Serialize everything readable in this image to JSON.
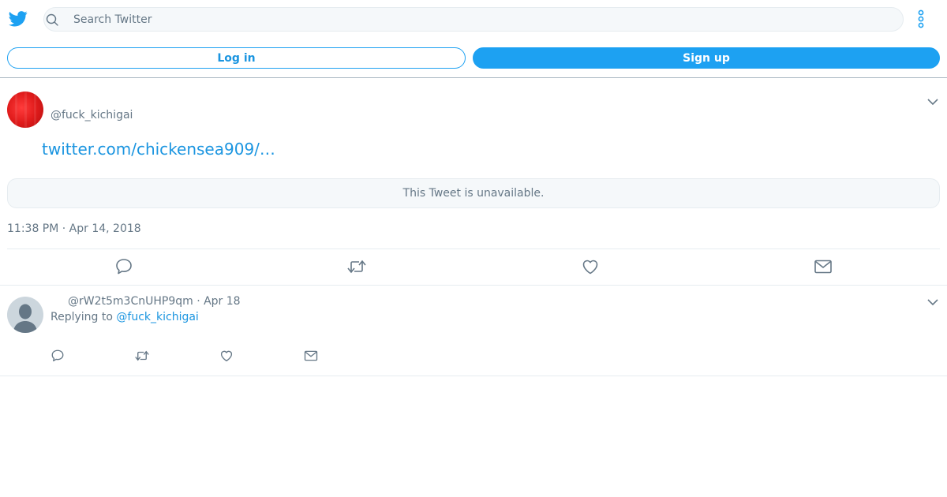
{
  "header": {
    "logo_icon": "twitter-bird-icon",
    "search_placeholder": "Search Twitter",
    "search_value": "",
    "more_icon": "more-vertical-icon",
    "accent_color": "#1da1f2"
  },
  "auth": {
    "login_label": "Log in",
    "signup_label": "Sign up"
  },
  "tweet": {
    "handle": "@fuck_kichigai",
    "link_text": "twitter.com/chickensea909/…",
    "quoted_status": "This Tweet is unavailable.",
    "timestamp": "11:38 PM · Apr 14, 2018",
    "actions": [
      "reply-icon",
      "retweet-icon",
      "like-icon",
      "share-dm-icon"
    ]
  },
  "reply": {
    "meta": "@rW2t5m3CnUHP9qm · Apr 18",
    "replying_prefix": "Replying to ",
    "replying_to": "@fuck_kichigai",
    "actions": [
      "reply-icon",
      "retweet-icon",
      "like-icon",
      "share-dm-icon"
    ]
  }
}
